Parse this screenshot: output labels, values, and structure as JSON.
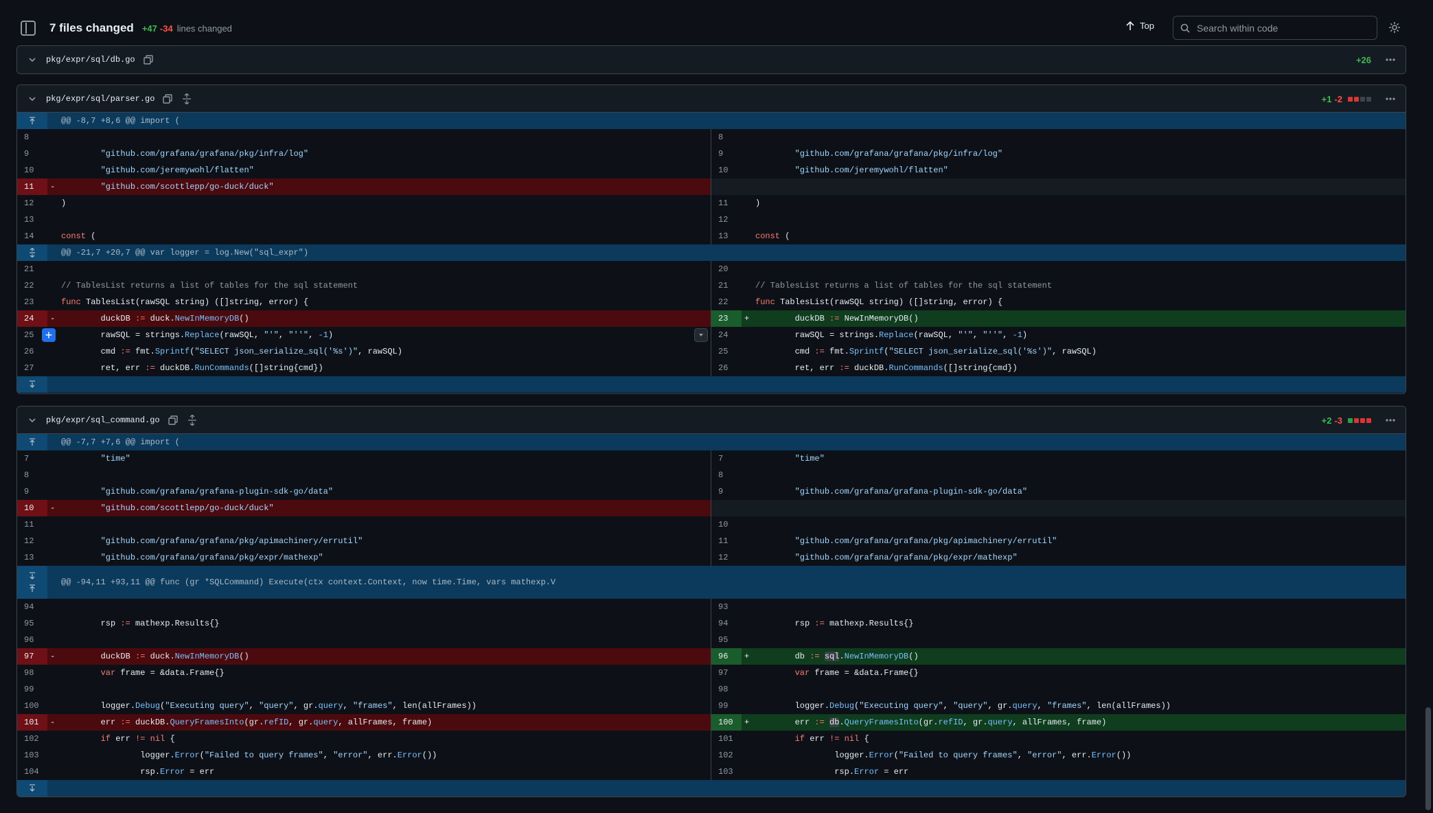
{
  "header": {
    "title": "7 files changed",
    "additions": "+47",
    "deletions": "-34",
    "lines_changed": "lines changed",
    "top_label": "Top",
    "search_placeholder": "Search within code"
  },
  "files": [
    {
      "name": "pkg/expr/sql/db.go",
      "additions": "+26",
      "deletions": ""
    },
    {
      "name": "pkg/expr/sql/parser.go",
      "additions": "+1",
      "deletions": "-2",
      "hunks": [
        "@@ -8,7 +8,6 @@ import (",
        "@@ -21,7 +20,7 @@ var logger = log.New(\"sql_expr\")"
      ],
      "rows": [
        {
          "l": "8",
          "lc": "",
          "r": "8",
          "rc": ""
        },
        {
          "l": "9",
          "lc": "\t\"github.com/grafana/grafana/pkg/infra/log\"",
          "r": "9",
          "rc": "\t\"github.com/grafana/grafana/pkg/infra/log\""
        },
        {
          "l": "10",
          "lc": "\t\"github.com/jeremywohl/flatten\"",
          "r": "10",
          "rc": "\t\"github.com/jeremywohl/flatten\""
        },
        {
          "l": "11",
          "lc": "\t\"github.com/scottlepp/go-duck/duck\"",
          "r": "",
          "rc": ""
        },
        {
          "l": "12",
          "lc": ")",
          "r": "11",
          "rc": ")"
        },
        {
          "l": "13",
          "lc": "",
          "r": "12",
          "rc": ""
        },
        {
          "l": "14",
          "lc": "const (",
          "r": "13",
          "rc": "const ("
        },
        {
          "l": "21",
          "lc": "",
          "r": "20",
          "rc": ""
        },
        {
          "l": "22",
          "lc": "// TablesList returns a list of tables for the sql statement",
          "r": "21",
          "rc": "// TablesList returns a list of tables for the sql statement"
        },
        {
          "l": "23",
          "lc": "func TablesList(rawSQL string) ([]string, error) {",
          "r": "22",
          "rc": "func TablesList(rawSQL string) ([]string, error) {"
        },
        {
          "l": "24",
          "lc": "\tduckDB := duck.NewInMemoryDB()",
          "r": "23",
          "rc": "\tduckDB := NewInMemoryDB()"
        },
        {
          "l": "25",
          "lc": "\trawSQL = strings.Replace(rawSQL, \"'\", \"''\", -1)",
          "r": "24",
          "rc": "\trawSQL = strings.Replace(rawSQL, \"'\", \"''\", -1)"
        },
        {
          "l": "26",
          "lc": "\tcmd := fmt.Sprintf(\"SELECT json_serialize_sql('%s')\", rawSQL)",
          "r": "25",
          "rc": "\tcmd := fmt.Sprintf(\"SELECT json_serialize_sql('%s')\", rawSQL)"
        },
        {
          "l": "27",
          "lc": "\tret, err := duckDB.RunCommands([]string{cmd})",
          "r": "26",
          "rc": "\tret, err := duckDB.RunCommands([]string{cmd})"
        }
      ]
    },
    {
      "name": "pkg/expr/sql_command.go",
      "additions": "+2",
      "deletions": "-3",
      "hunks": [
        "@@ -7,7 +7,6 @@ import (",
        "@@ -94,11 +93,11 @@ func (gr *SQLCommand) Execute(ctx context.Context, now time.Time, vars mathexp.V"
      ],
      "rows": [
        {
          "l": "7",
          "lc": "\t\"time\"",
          "r": "7",
          "rc": "\t\"time\""
        },
        {
          "l": "8",
          "lc": "",
          "r": "8",
          "rc": ""
        },
        {
          "l": "9",
          "lc": "\t\"github.com/grafana/grafana-plugin-sdk-go/data\"",
          "r": "9",
          "rc": "\t\"github.com/grafana/grafana-plugin-sdk-go/data\""
        },
        {
          "l": "10",
          "lc": "\t\"github.com/scottlepp/go-duck/duck\"",
          "r": "",
          "rc": ""
        },
        {
          "l": "11",
          "lc": "",
          "r": "10",
          "rc": ""
        },
        {
          "l": "12",
          "lc": "\t\"github.com/grafana/grafana/pkg/apimachinery/errutil\"",
          "r": "11",
          "rc": "\t\"github.com/grafana/grafana/pkg/apimachinery/errutil\""
        },
        {
          "l": "13",
          "lc": "\t\"github.com/grafana/grafana/pkg/expr/mathexp\"",
          "r": "12",
          "rc": "\t\"github.com/grafana/grafana/pkg/expr/mathexp\""
        },
        {
          "l": "94",
          "lc": "",
          "r": "93",
          "rc": ""
        },
        {
          "l": "95",
          "lc": "\trsp := mathexp.Results{}",
          "r": "94",
          "rc": "\trsp := mathexp.Results{}"
        },
        {
          "l": "96",
          "lc": "",
          "r": "95",
          "rc": ""
        },
        {
          "l": "97",
          "lc": "\tduckDB := duck.NewInMemoryDB()",
          "r": "96",
          "rc": "\tdb := sql.NewInMemoryDB()"
        },
        {
          "l": "98",
          "lc": "\tvar frame = &data.Frame{}",
          "r": "97",
          "rc": "\tvar frame = &data.Frame{}"
        },
        {
          "l": "99",
          "lc": "",
          "r": "98",
          "rc": ""
        },
        {
          "l": "100",
          "lc": "\tlogger.Debug(\"Executing query\", \"query\", gr.query, \"frames\", len(allFrames))",
          "r": "99",
          "rc": "\tlogger.Debug(\"Executing query\", \"query\", gr.query, \"frames\", len(allFrames))"
        },
        {
          "l": "101",
          "lc": "\terr := duckDB.QueryFramesInto(gr.refID, gr.query, allFrames, frame)",
          "r": "100",
          "rc": "\terr := db.QueryFramesInto(gr.refID, gr.query, allFrames, frame)"
        },
        {
          "l": "102",
          "lc": "\tif err != nil {",
          "r": "101",
          "rc": "\tif err != nil {"
        },
        {
          "l": "103",
          "lc": "\t\tlogger.Error(\"Failed to query frames\", \"error\", err.Error())",
          "r": "102",
          "rc": "\t\tlogger.Error(\"Failed to query frames\", \"error\", err.Error())"
        },
        {
          "l": "104",
          "lc": "\t\trsp.Error = err",
          "r": "103",
          "rc": "\t\trsp.Error = err"
        }
      ]
    }
  ],
  "colors": {
    "background": "#0d1117",
    "addition": "#3fb950",
    "deletion": "#f85149",
    "hunk": "#0b3a5c"
  }
}
